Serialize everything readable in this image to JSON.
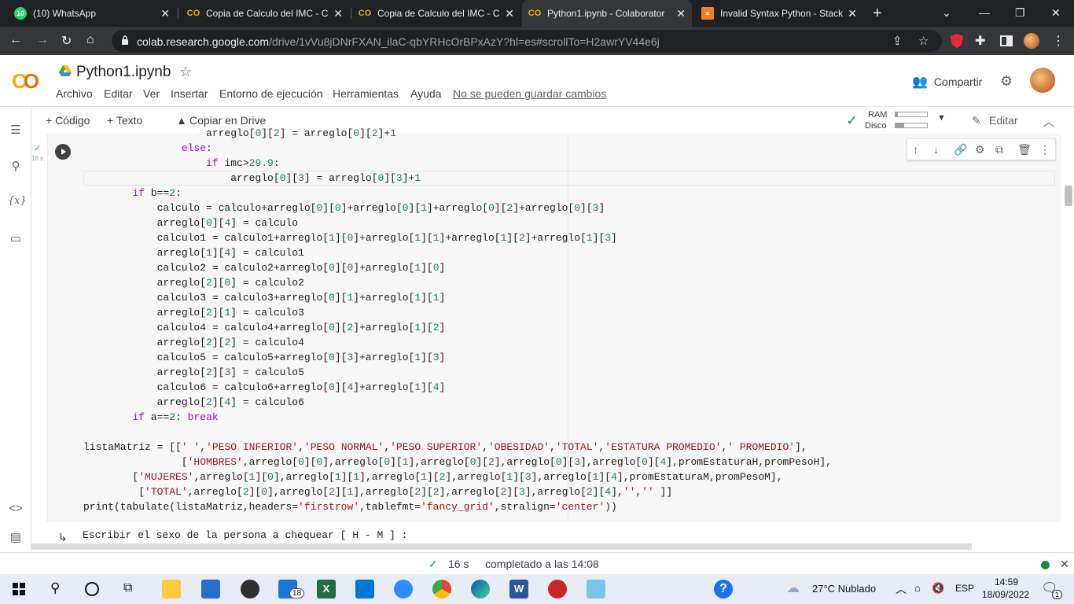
{
  "browser": {
    "tabs": [
      {
        "title": "(10) WhatsApp",
        "icon": "whatsapp-icon",
        "color": "#25d366"
      },
      {
        "title": "Copia de Calculo del IMC - C",
        "icon": "colab-icon",
        "color": "#f9ab00"
      },
      {
        "title": "Copia de Calculo del IMC - C",
        "icon": "colab-icon",
        "color": "#f9ab00"
      },
      {
        "title": "Python1.ipynb - Colaborator",
        "icon": "colab-icon",
        "color": "#f9ab00"
      },
      {
        "title": "Invalid Syntax Python - Stack",
        "icon": "stackoverflow-icon",
        "color": "#f48024"
      }
    ],
    "url_host": "colab.research.google.com",
    "url_path": "/drive/1vVu8jDNrFXAN_ilaC-qbYRHcOrBPxAzY?hl=es#scrollTo=H2awrYV44e6j"
  },
  "colab": {
    "title": "Python1.ipynb",
    "menu": [
      "Archivo",
      "Editar",
      "Ver",
      "Insertar",
      "Entorno de ejecución",
      "Herramientas",
      "Ayuda"
    ],
    "unsaved": "No se pueden guardar cambios",
    "share": "Compartir",
    "toolbar": {
      "code": "+ Código",
      "text": "+ Texto",
      "copy_drive": "Copiar en Drive",
      "ram": "RAM",
      "disk": "Disco",
      "edit": "Editar"
    },
    "exec_time": "16 s"
  },
  "code_lines": [
    "                    arreglo[0][2] = arreglo[0][2]+1",
    "                else:",
    "                    if imc>29.9:",
    "                        arreglo[0][3] = arreglo[0][3]+1",
    "        if b==2:",
    "            calculo = calculo+arreglo[0][0]+arreglo[0][1]+arreglo[0][2]+arreglo[0][3]",
    "            arreglo[0][4] = calculo",
    "            calculo1 = calculo1+arreglo[1][0]+arreglo[1][1]+arreglo[1][2]+arreglo[1][3]",
    "            arreglo[1][4] = calculo1",
    "            calculo2 = calculo2+arreglo[0][0]+arreglo[1][0]",
    "            arreglo[2][0] = calculo2",
    "            calculo3 = calculo3+arreglo[0][1]+arreglo[1][1]",
    "            arreglo[2][1] = calculo3",
    "            calculo4 = calculo4+arreglo[0][2]+arreglo[1][2]",
    "            arreglo[2][2] = calculo4",
    "            calculo5 = calculo5+arreglo[0][3]+arreglo[1][3]",
    "            arreglo[2][3] = calculo5",
    "            calculo6 = calculo6+arreglo[0][4]+arreglo[1][4]",
    "            arreglo[2][4] = calculo6",
    "        if a==2: break",
    "",
    "listaMatriz = [[' ','PESO INFERIOR','PESO NORMAL','PESO SUPERIOR','OBESIDAD','TOTAL','ESTATURA PROMEDIO',' PROMEDIO'],",
    "                ['HOMBRES',arreglo[0][0],arreglo[0][1],arreglo[0][2],arreglo[0][3],arreglo[0][4],promEstaturaH,promPesoH],",
    "        ['MUJERES',arreglo[1][0],arreglo[1][1],arreglo[1][2],arreglo[1][3],arreglo[1][4],promEstaturaM,promPesoM],",
    "         ['TOTAL',arreglo[2][0],arreglo[2][1],arreglo[2][2],arreglo[2][3],arreglo[2][4],'','' ]]",
    "print(tabulate(listaMatriz,headers='firstrow',tablefmt='fancy_grid',stralign='center'))"
  ],
  "output_text": "Escribir el sexo de la persona a chequear [ H - M ] :",
  "status": {
    "time": "16 s",
    "completed": "completado a las 14:08"
  },
  "taskbar": {
    "weather": "27°C  Nublado",
    "lang": "ESP",
    "time": "14:59",
    "date": "18/09/2022",
    "mail_badge": "18",
    "notif_badge": "1"
  }
}
